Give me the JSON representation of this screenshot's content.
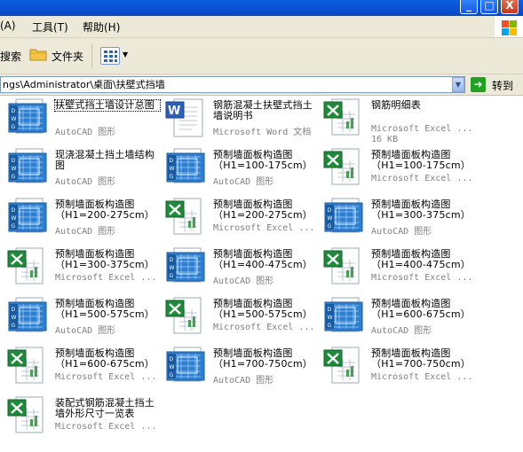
{
  "title_buttons": {
    "minimize": "_",
    "maximize": "□",
    "close": "X"
  },
  "menu": [
    "(A)",
    "工具(T)",
    "帮助(H)"
  ],
  "toolbar": {
    "search_label": "搜索",
    "folders_label": "文件夹"
  },
  "address": {
    "path": "ngs\\Administrator\\桌面\\扶壁式挡墙",
    "go_label": "转到"
  },
  "colors": {
    "titlebar": "#0a5fe0",
    "chrome": "#ece9d8",
    "go_green": "#21a121"
  },
  "files": [
    {
      "name": "扶壁式挡土墙设计总图",
      "type": "AutoCAD 图形",
      "icon": "autocad-dwg-icon",
      "selected": true
    },
    {
      "name": "钢筋混凝土扶壁式挡土墙说明书",
      "type": "Microsoft Word 文档",
      "icon": "word-document-icon"
    },
    {
      "name": "钢筋明细表",
      "type": "Microsoft Excel ...",
      "size": "16 KB",
      "icon": "excel-worksheet-icon"
    },
    {
      "name": "现浇混凝土挡土墙结构图",
      "type": "AutoCAD 图形",
      "icon": "autocad-dwg-icon"
    },
    {
      "name": "预制墙面板构造图（H1=100-175cm）",
      "type": "AutoCAD 图形",
      "icon": "autocad-dwg-icon"
    },
    {
      "name": "预制墙面板构造图（H1=100-175cm）",
      "type": "Microsoft Excel ...",
      "icon": "excel-worksheet-icon"
    },
    {
      "name": "预制墙面板构造图（H1=200-275cm）",
      "type": "AutoCAD 图形",
      "icon": "autocad-dwg-icon"
    },
    {
      "name": "预制墙面板构造图（H1=200-275cm）",
      "type": "Microsoft Excel ...",
      "icon": "excel-worksheet-icon"
    },
    {
      "name": "预制墙面板构造图（H1=300-375cm）",
      "type": "AutoCAD 图形",
      "icon": "autocad-dwg-icon"
    },
    {
      "name": "预制墙面板构造图（H1=300-375cm）",
      "type": "Microsoft Excel ...",
      "icon": "excel-worksheet-icon"
    },
    {
      "name": "预制墙面板构造图（H1=400-475cm）",
      "type": "AutoCAD 图形",
      "icon": "autocad-dwg-icon"
    },
    {
      "name": "预制墙面板构造图（H1=400-475cm）",
      "type": "Microsoft Excel ...",
      "icon": "excel-worksheet-icon"
    },
    {
      "name": "预制墙面板构造图（H1=500-575cm）",
      "type": "AutoCAD 图形",
      "icon": "autocad-dwg-icon"
    },
    {
      "name": "预制墙面板构造图（H1=500-575cm）",
      "type": "Microsoft Excel ...",
      "icon": "excel-worksheet-icon"
    },
    {
      "name": "预制墙面板构造图（H1=600-675cm）",
      "type": "AutoCAD 图形",
      "icon": "autocad-dwg-icon"
    },
    {
      "name": "预制墙面板构造图（H1=600-675cm）",
      "type": "Microsoft Excel ...",
      "icon": "excel-worksheet-icon"
    },
    {
      "name": "预制墙面板构造图（H1=700-750cm）",
      "type": "AutoCAD 图形",
      "icon": "autocad-dwg-icon"
    },
    {
      "name": "预制墙面板构造图（H1=700-750cm）",
      "type": "Microsoft Excel ...",
      "icon": "excel-worksheet-icon"
    },
    {
      "name": "装配式钢筋混凝土挡土墙外形尺寸一览表",
      "type": "Microsoft Excel ...",
      "icon": "excel-worksheet-icon"
    }
  ]
}
